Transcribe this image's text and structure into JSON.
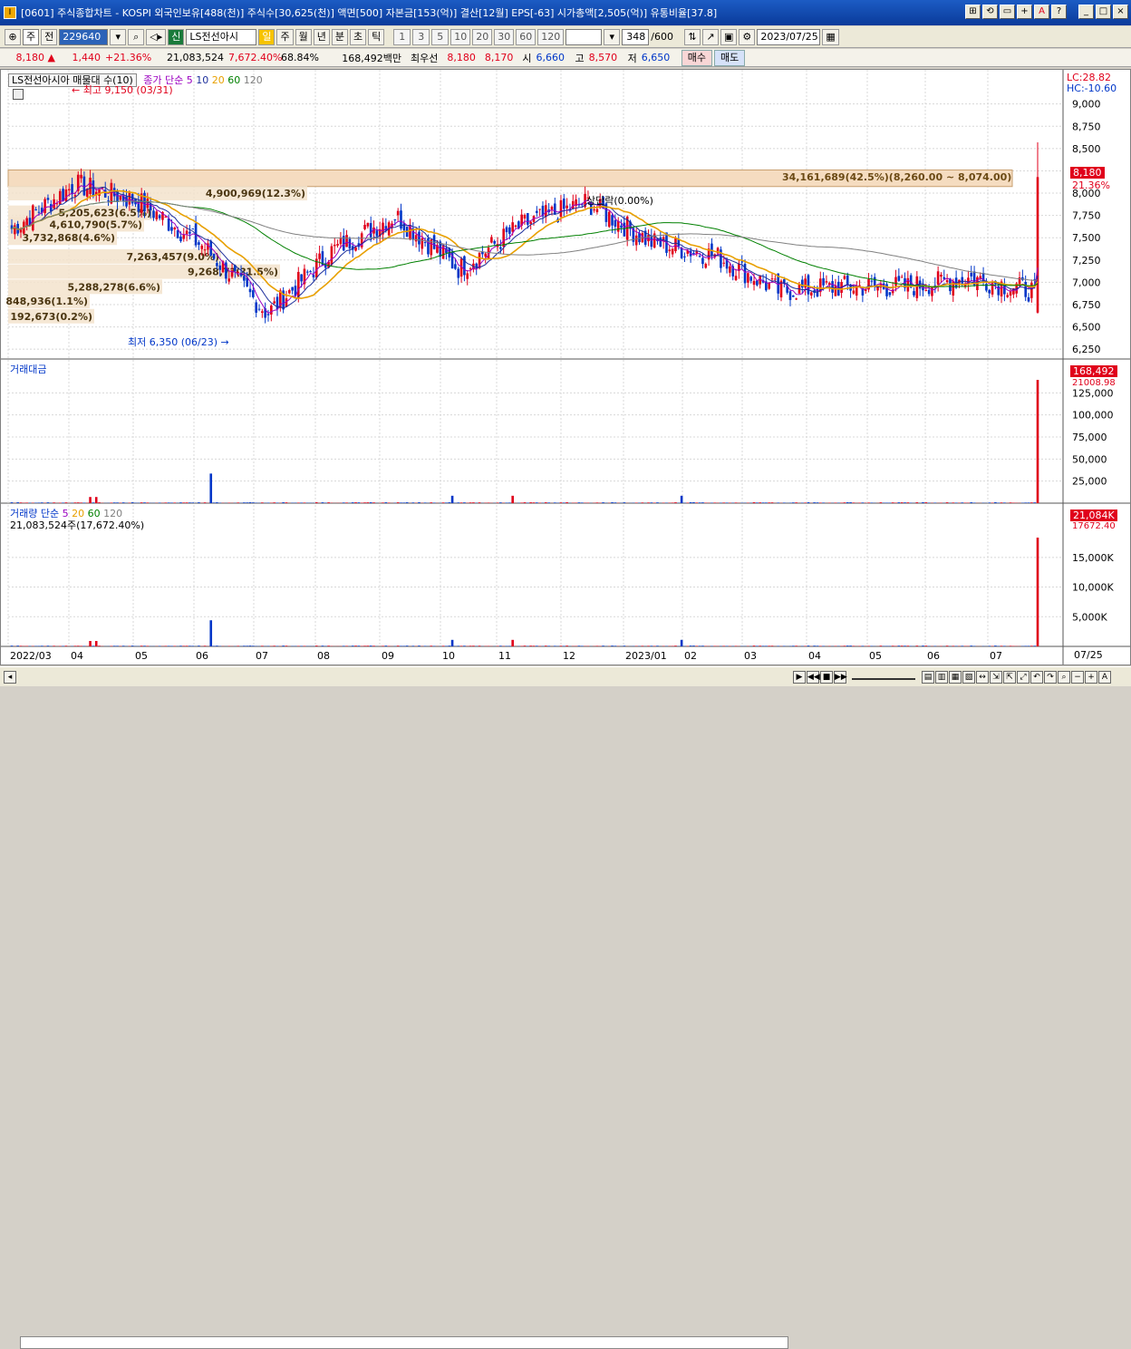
{
  "window": {
    "title": "[0601] 주식종합차트 - KOSPI 외국인보유[488(천)] 주식수[30,625(천)] 액면[500] 자본금[153(억)] 결산[12월] EPS[-63] 시가총액[2,505(억)] 유통비율[37.8]",
    "app_icon": "I",
    "buttons": [
      "⊞",
      "⟲",
      "▭",
      "+",
      "A",
      "?",
      "_",
      "□",
      "×"
    ]
  },
  "toolbar": {
    "week_label": "주",
    "prev_label": "전",
    "stock_code": "229640",
    "stock_name": "LS전선아시",
    "sin_label": "신",
    "period_tabs": [
      "일",
      "주",
      "월",
      "년",
      "분",
      "초",
      "틱"
    ],
    "minute_buttons": [
      "1",
      "3",
      "5",
      "10",
      "20",
      "30",
      "60",
      "120"
    ],
    "count": "348",
    "count_max": "/600",
    "date": "2023/07/25"
  },
  "quote": {
    "price": "8,180 ▲",
    "change": "1,440",
    "change_pct": "+21.36%",
    "volume": "21,083,524",
    "volume_pct": "7,672.40%",
    "turnover": "68.84%",
    "amount": "168,492백만",
    "ask_label": "최우선",
    "ask": "8,180",
    "bid": "8,170",
    "open_label": "시",
    "open": "6,660",
    "high_label": "고",
    "high": "8,570",
    "low_label": "저",
    "low": "6,650",
    "buy_label": "매수",
    "sell_label": "매도"
  },
  "price_pane": {
    "title": "LS전선아시아 매물대 수(10)",
    "ma_label": "종가 단순",
    "ma_periods": [
      "5",
      "10",
      "20",
      "60",
      "120"
    ],
    "max_label": "← 최고 9,150 (03/31)",
    "min_label": "최저 6,350 (06/23) →",
    "lc": "LC:28.82",
    "hc": "HC:-10.60",
    "last_price_badge": "8,180",
    "last_pct": "21.36%",
    "band_label": "34,161,689(42.5%)(8,260.00 ~ 8,074.00)",
    "stage_label": "상단락(0.00%)",
    "volume_profile": [
      "4,900,969(12.3%)",
      "5,205,623(6.5%)",
      "4,610,790(5.7%)",
      "3,732,868(4.6%)",
      "7,263,457(9.0%)",
      "9,268,7?(?1.5%)",
      "5,288,278(6.6%)",
      "848,936(1.1%)",
      "192,673(0.2%)"
    ]
  },
  "amount_pane": {
    "title": "거래대금",
    "badge": "168,492",
    "badge_sub": "21008.98",
    "axis": [
      "125,000",
      "100,000",
      "75,000",
      "50,000",
      "25,000"
    ]
  },
  "volume_pane": {
    "title": "거래량 단순",
    "ma_periods": [
      "5",
      "20",
      "60",
      "120"
    ],
    "current": "21,083,524주(17,672.40%)",
    "badge": "21,084K",
    "badge_sub": "17672.40",
    "axis": [
      "15,000K",
      "10,000K",
      "5,000K"
    ]
  },
  "x_axis": {
    "labels": [
      "2022/03",
      "04",
      "05",
      "06",
      "07",
      "08",
      "09",
      "10",
      "11",
      "12",
      "2023/01",
      "02",
      "03",
      "04",
      "05",
      "06",
      "07"
    ],
    "right_label": "07/25"
  },
  "chart_data": {
    "type": "candlestick",
    "price_axis": [
      "9,000",
      "8,750",
      "8,500",
      "8,250",
      "8,000",
      "7,750",
      "7,500",
      "7,250",
      "7,000",
      "6,750",
      "6,500",
      "6,250"
    ],
    "ylim": [
      6150,
      9200
    ],
    "months": [
      "2022/03",
      "04",
      "05",
      "06",
      "07",
      "08",
      "09",
      "10",
      "11",
      "12",
      "2023/01",
      "02",
      "03",
      "04",
      "05",
      "06",
      "07"
    ],
    "close_path_monthly": [
      7600,
      8100,
      7900,
      7400,
      6650,
      7350,
      7750,
      7150,
      7650,
      7900,
      7450,
      7300,
      6900,
      6950,
      6950,
      7050,
      6900
    ],
    "final_close": 8180,
    "final_high": 8570,
    "final_low": 6650,
    "colors": {
      "up": "#e0001b",
      "down": "#0036c8",
      "ma5": "#9b00c0",
      "ma10": "#1d2f9c",
      "ma20": "#e8a000",
      "ma60": "#008000",
      "ma120": "#808080"
    }
  }
}
